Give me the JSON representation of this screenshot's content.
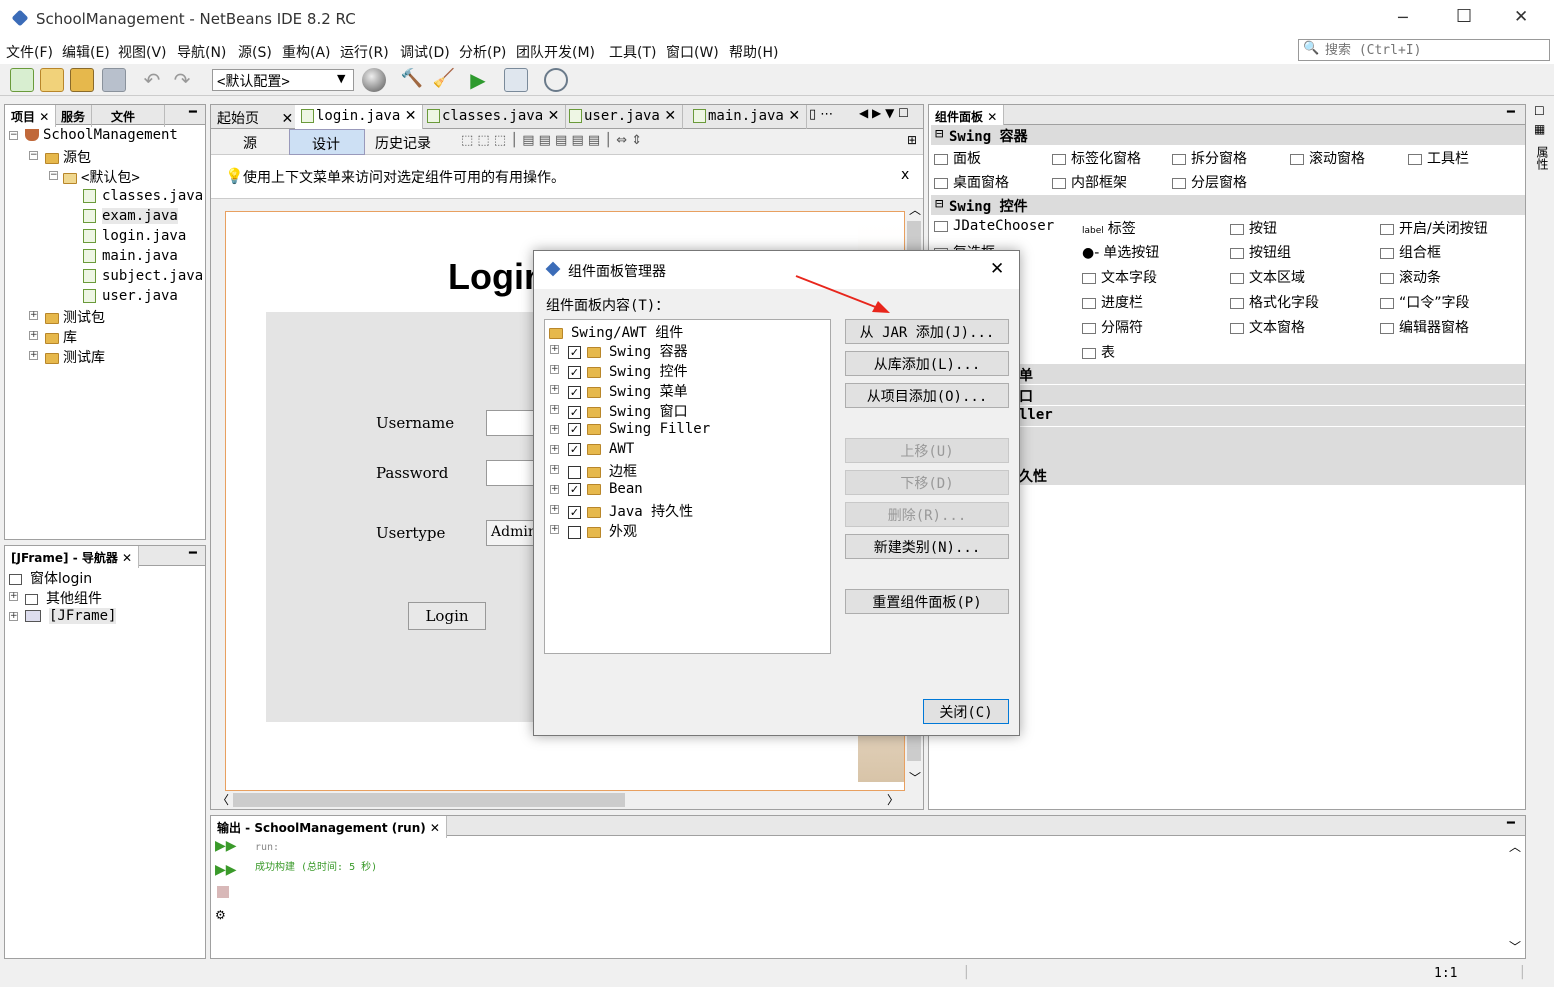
{
  "window": {
    "title": "SchoolManagement - NetBeans IDE 8.2 RC",
    "minimize": "─",
    "maximize": "☐",
    "close": "✕"
  },
  "menus": [
    "文件(F)",
    "编辑(E)",
    "视图(V)",
    "导航(N)",
    "源(S)",
    "重构(A)",
    "运行(R)",
    "调试(D)",
    "分析(P)",
    "团队开发(M)",
    "工具(T)",
    "窗口(W)",
    "帮助(H)"
  ],
  "search": {
    "placeholder": "搜索 (Ctrl+I)"
  },
  "toolbar": {
    "config": "<默认配置>"
  },
  "project_panel": {
    "tabs": [
      "项目",
      "服务",
      "文件"
    ],
    "tree": {
      "root": "SchoolManagement",
      "source": "源包",
      "default_pkg": "<默认包>",
      "files": [
        "classes.java",
        "exam.java",
        "login.java",
        "main.java",
        "subject.java",
        "user.java"
      ],
      "test_pkg": "测试包",
      "lib": "库",
      "test_lib": "测试库"
    }
  },
  "navigator": {
    "title": "[JFrame] - 导航器",
    "items": [
      "窗体login",
      "其他组件",
      "[JFrame]"
    ]
  },
  "editor": {
    "tabs": [
      "起始页",
      "login.java",
      "classes.java",
      "user.java",
      "main.java"
    ],
    "subtabs": [
      "源",
      "设计",
      "历史记录"
    ],
    "hint": "使用上下文菜单来访问对选定组件可用的有用操作。",
    "hint_close": "x",
    "form": {
      "title": "Login",
      "username": "Username",
      "password": "Password",
      "usertype": "Usertype",
      "usertype_value": "Admin",
      "login_btn": "Login"
    }
  },
  "palette": {
    "title": "组件面板",
    "side": "属性",
    "swing_containers": "Swing 容器",
    "containers": [
      "面板",
      "标签化窗格",
      "拆分窗格",
      "滚动窗格",
      "工具栏",
      "桌面窗格",
      "内部框架",
      "分层窗格"
    ],
    "swing_controls": "Swing 控件",
    "controls": [
      "JDateChooser",
      "标签",
      "按钮",
      "开启/关闭按钮",
      "复选框",
      "单选按钮",
      "按钮组",
      "组合框",
      "文本字段",
      "文本区域",
      "滚动条",
      "进度栏",
      "格式化字段",
      "“口令”字段",
      "分隔符",
      "文本窗格",
      "编辑器窗格",
      "表"
    ],
    "label_icon": "label",
    "collapsed": [
      "单",
      "口",
      "ller",
      "久性"
    ]
  },
  "dialog": {
    "title": "组件面板管理器",
    "content_label": "组件面板内容(T)：",
    "root": "Swing/AWT 组件",
    "categories": [
      {
        "name": "Swing 容器",
        "checked": true
      },
      {
        "name": "Swing 控件",
        "checked": true
      },
      {
        "name": "Swing 菜单",
        "checked": true
      },
      {
        "name": "Swing 窗口",
        "checked": true
      },
      {
        "name": "Swing Filler",
        "checked": true
      },
      {
        "name": "AWT",
        "checked": true
      },
      {
        "name": "边框",
        "checked": false
      },
      {
        "name": "Bean",
        "checked": true
      },
      {
        "name": "Java 持久性",
        "checked": true
      },
      {
        "name": "外观",
        "checked": false
      }
    ],
    "buttons": {
      "add_jar": "从 JAR 添加(J)...",
      "add_lib": "从库添加(L)...",
      "add_project": "从项目添加(O)...",
      "up": "上移(U)",
      "down": "下移(D)",
      "delete": "删除(R)...",
      "new_category": "新建类别(N)...",
      "reset": "重置组件面板(P)",
      "close": "关闭(C)"
    },
    "close_x": "✕"
  },
  "output": {
    "title": "输出 - SchoolManagement (run)",
    "lines": [
      "run:",
      "成功构建 (总时间: 5 秒)"
    ]
  },
  "status": {
    "position": "1:1"
  },
  "colors": {
    "accent_red": "#e8261c",
    "success_green": "#3a9a2a",
    "selection": "#c6dcf5"
  }
}
